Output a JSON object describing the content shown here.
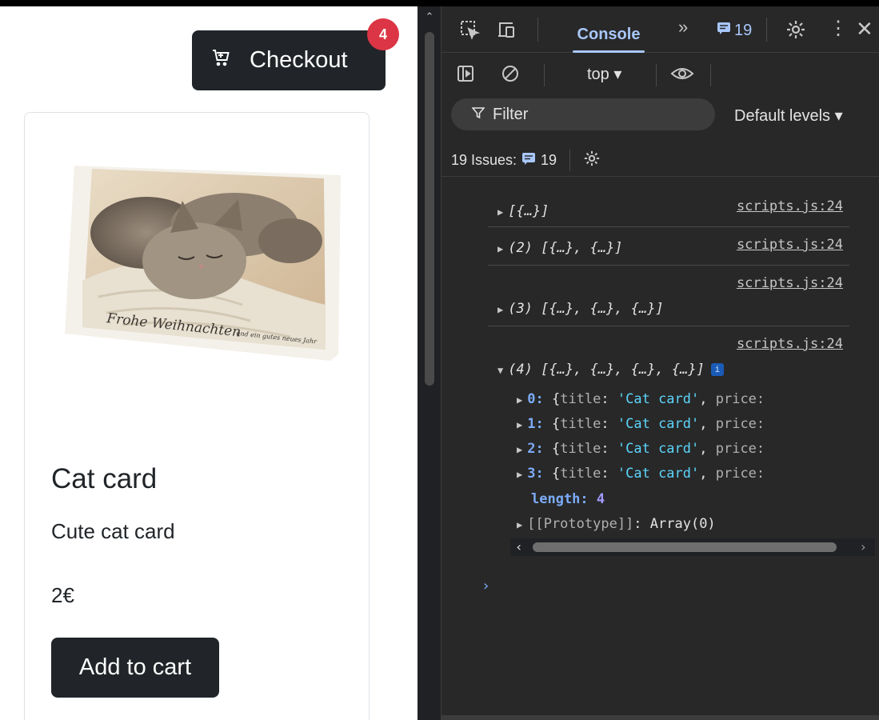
{
  "page": {
    "checkout_label": "Checkout",
    "cart_count": "4",
    "product": {
      "title": "Cat card",
      "description": "Cute cat card",
      "price": "2€",
      "image_caption": "Frohe Weihnachten",
      "image_caption_sub": "und ein gutes neues Jahr",
      "add_label": "Add to cart"
    }
  },
  "devtools": {
    "tabs": {
      "console_label": "Console",
      "more_glyph": "»",
      "message_count": "19"
    },
    "toolbar": {
      "context": "top ▾"
    },
    "filter": {
      "placeholder": "Filter",
      "levels": "Default levels ▾"
    },
    "issues": {
      "label": "19 Issues:",
      "count": "19"
    },
    "console": {
      "entries": [
        {
          "source": "scripts.js:24",
          "summary": "[{…}]"
        },
        {
          "source": "scripts.js:24",
          "summary": "(2) [{…}, {…}]"
        },
        {
          "source": "scripts.js:24",
          "summary": "(3) [{…}, {…}, {…}]"
        },
        {
          "source": "scripts.js:24",
          "summary": "(4) [{…}, {…}, {…}, {…}]"
        }
      ],
      "expanded_items": [
        {
          "index": "0",
          "key": "title",
          "value": "'Cat card'",
          "more": "price:"
        },
        {
          "index": "1",
          "key": "title",
          "value": "'Cat card'",
          "more": "price:"
        },
        {
          "index": "2",
          "key": "title",
          "value": "'Cat card'",
          "more": "price:"
        },
        {
          "index": "3",
          "key": "title",
          "value": "'Cat card'",
          "more": "price:"
        }
      ],
      "length_key": "length",
      "length_value": "4",
      "prototype_key": "[[Prototype]]",
      "prototype_value": "Array(0)",
      "info_badge": "i",
      "prompt": "›"
    },
    "colors": {
      "background": "#282828",
      "accent": "#a8c7fa",
      "string": "#5cd5fb",
      "number": "#a29bff"
    }
  }
}
